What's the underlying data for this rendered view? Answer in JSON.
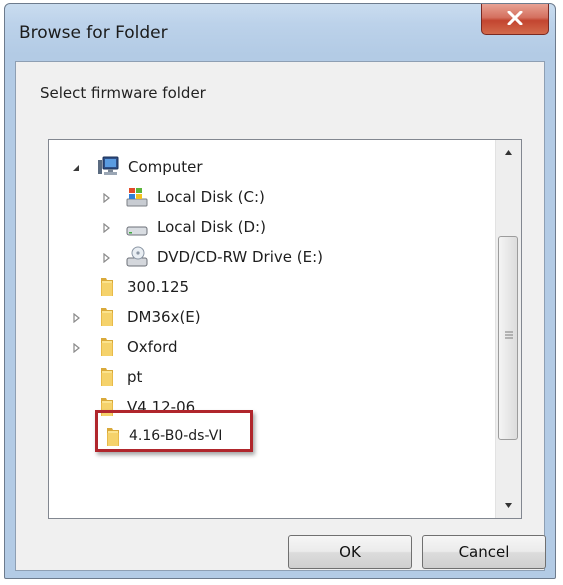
{
  "window": {
    "title": "Browse for Folder",
    "prompt": "Select firmware folder"
  },
  "tree": {
    "items": [
      {
        "label": "Computer",
        "icon": "computer-icon",
        "expander": "expanded"
      },
      {
        "label": "Local Disk (C:)",
        "icon": "windows-drive-icon",
        "expander": "collapsed"
      },
      {
        "label": "Local Disk (D:)",
        "icon": "drive-icon",
        "expander": "collapsed"
      },
      {
        "label": "DVD/CD-RW Drive (E:)",
        "icon": "dvd-drive-icon",
        "expander": "collapsed"
      },
      {
        "label": "300.125",
        "icon": "folder-icon",
        "expander": "none"
      },
      {
        "label": "DM36x(E)",
        "icon": "folder-icon",
        "expander": "collapsed"
      },
      {
        "label": "Oxford",
        "icon": "folder-icon",
        "expander": "collapsed"
      },
      {
        "label": "pt",
        "icon": "folder-icon",
        "expander": "none"
      },
      {
        "label": "V4.12-06",
        "icon": "folder-icon",
        "expander": "none"
      },
      {
        "label": "4.16-B0-ds-VI",
        "icon": "folder-icon",
        "expander": "none",
        "highlighted": true
      }
    ]
  },
  "buttons": {
    "ok": "OK",
    "cancel": "Cancel"
  },
  "colors": {
    "highlight_border": "#b0262c",
    "close_button": "#c34530",
    "title_bar": "#bcd2ea"
  }
}
